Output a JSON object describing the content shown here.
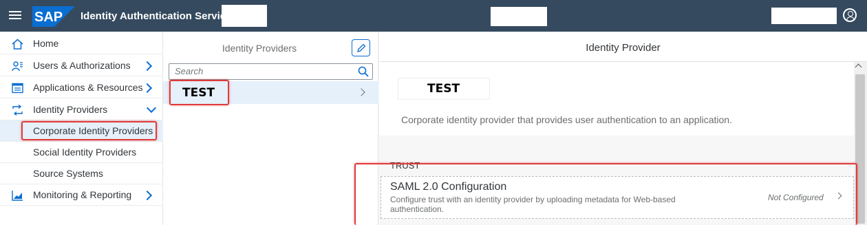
{
  "shell": {
    "title": "Identity Authentication Service",
    "brand": "SAP",
    "brand_color": "#0a6ed1",
    "bar_color": "#354a5f"
  },
  "nav": {
    "items": [
      {
        "label": "Home",
        "icon": "home-icon"
      },
      {
        "label": "Users & Authorizations",
        "icon": "users-icon"
      },
      {
        "label": "Applications & Resources",
        "icon": "applications-icon"
      },
      {
        "label": "Identity Providers",
        "icon": "identity-providers-icon",
        "expanded": true
      },
      {
        "label": "Corporate Identity Providers",
        "selected": true
      },
      {
        "label": "Social Identity Providers"
      },
      {
        "label": "Source Systems"
      },
      {
        "label": "Monitoring & Reporting",
        "icon": "monitoring-icon"
      }
    ]
  },
  "list": {
    "title": "Identity Providers",
    "search_placeholder": "Search",
    "rows": [
      {
        "label": "TEST"
      }
    ]
  },
  "detail": {
    "header": "Identity Provider",
    "object_title": "TEST",
    "description": "Corporate identity provider that provides user authentication to an application.",
    "section": "TRUST",
    "config": {
      "title": "SAML 2.0 Configuration",
      "description": "Configure trust with an identity provider by uploading metadata for Web-based authentication.",
      "status": "Not Configured"
    }
  },
  "highlight_color": "#e03b3b"
}
